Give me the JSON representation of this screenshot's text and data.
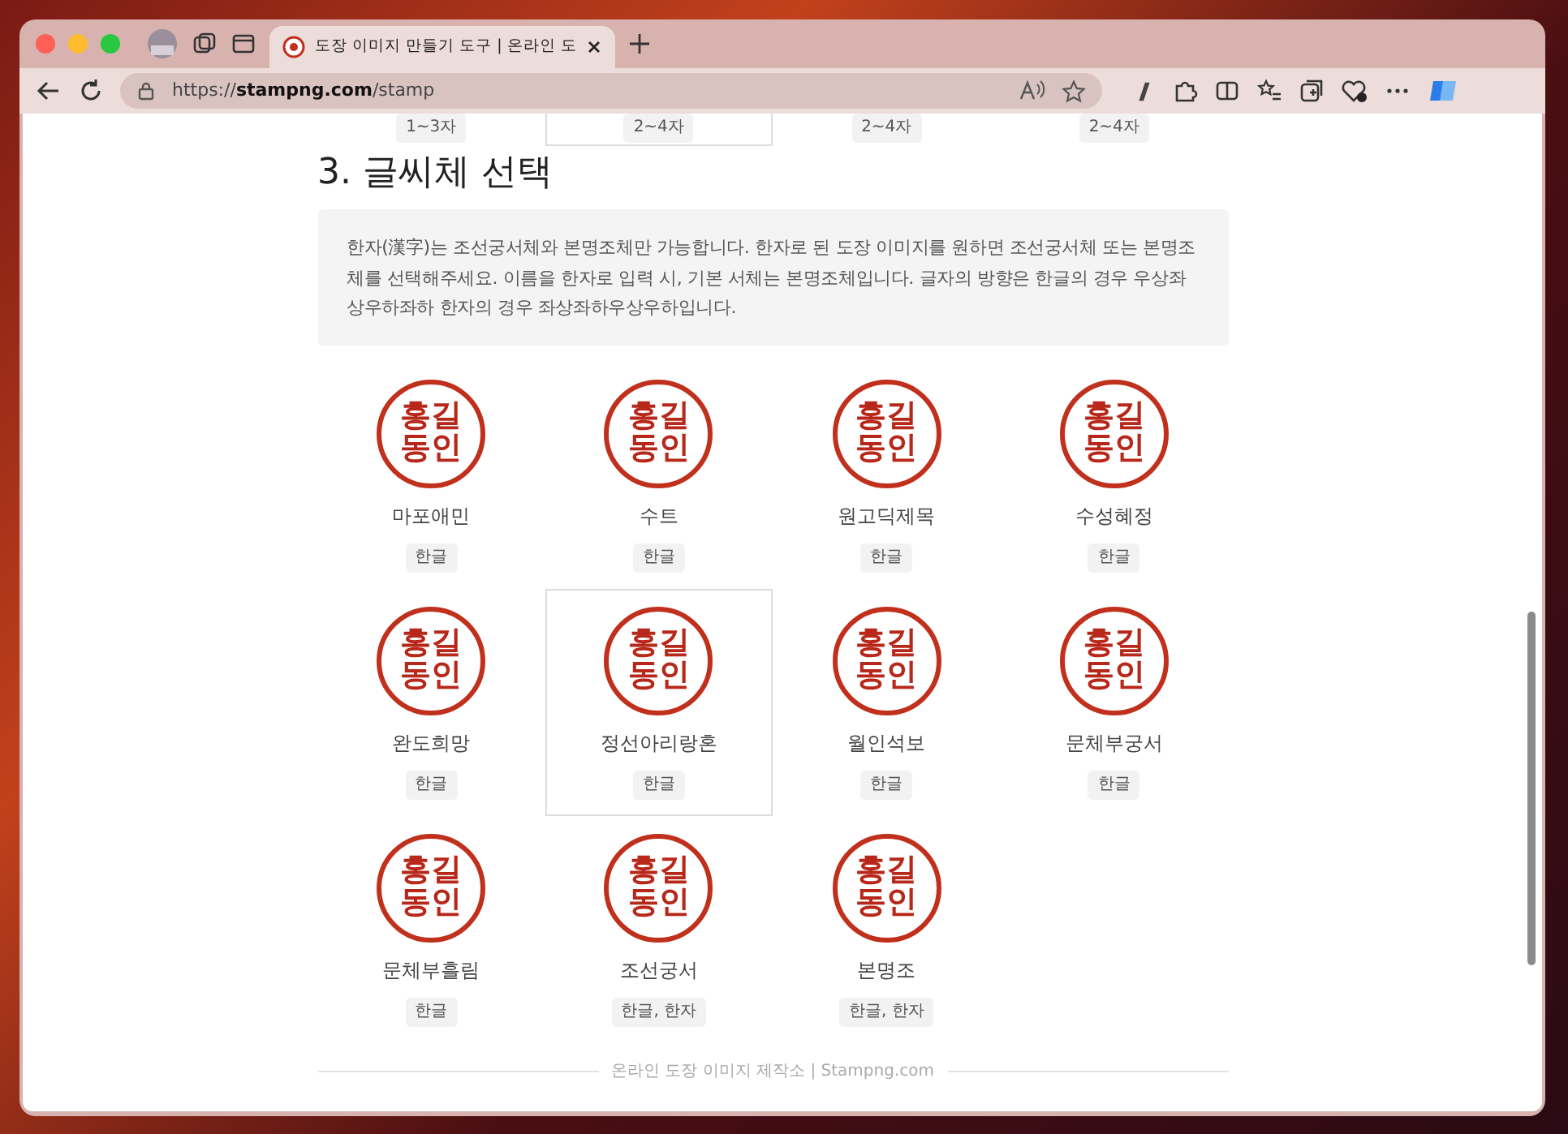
{
  "browser": {
    "tab": {
      "title": "도장 이미지 만들기 도구 | 온라인 도",
      "selected": true
    },
    "url": "https://**stampng.com**/stamp"
  },
  "previous_row": [
    {
      "tag": "1~3자",
      "selected": false
    },
    {
      "tag": "2~4자",
      "selected": true
    },
    {
      "tag": "2~4자",
      "selected": false
    },
    {
      "tag": "2~4자",
      "selected": false
    }
  ],
  "section": {
    "heading": "3. 글씨체 선택",
    "notice": "한자(漢字)는 조선궁서체와 본명조체만 가능합니다. 한자로 된 도장 이미지를 원하면 조선궁서체 또는 본명조체를 선택해주세요. 이름을 한자로 입력 시, 기본 서체는 본명조체입니다. 글자의 방향은 한글의 경우 우상좌상우하좌하 한자의 경우 좌상좌하우상우하입니다.",
    "fonts": [
      {
        "seal": "홍길동인",
        "name": "마포애민",
        "tag": "한글",
        "selected": false
      },
      {
        "seal": "홍길동인",
        "name": "수트",
        "tag": "한글",
        "selected": false
      },
      {
        "seal": "홍길동인",
        "name": "원고딕제목",
        "tag": "한글",
        "selected": false
      },
      {
        "seal": "홍길동인",
        "name": "수성혜정",
        "tag": "한글",
        "selected": false
      },
      {
        "seal": "홍길동인",
        "name": "완도희망",
        "tag": "한글",
        "selected": false
      },
      {
        "seal": "홍길동인",
        "name": "정선아리랑혼",
        "tag": "한글",
        "selected": true
      },
      {
        "seal": "홍길동인",
        "name": "월인석보",
        "tag": "한글",
        "selected": false
      },
      {
        "seal": "홍길동인",
        "name": "문체부궁서",
        "tag": "한글",
        "selected": false
      },
      {
        "seal": "홍길동인",
        "name": "문체부흘림",
        "tag": "한글",
        "selected": false
      },
      {
        "seal": "홍길동인",
        "name": "조선궁서",
        "tag": "한글, 한자",
        "selected": false
      },
      {
        "seal": "홍길동인",
        "name": "본명조",
        "tag": "한글, 한자",
        "selected": false
      }
    ]
  },
  "footer": "온라인 도장 이미지 제작소 | Stampng.com"
}
